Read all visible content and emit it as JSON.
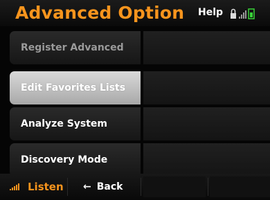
{
  "header": {
    "title": "Advanced Option",
    "help_label": "Help",
    "icons": [
      "lock-icon",
      "signal-bars-icon",
      "battery-icon"
    ]
  },
  "menu": {
    "items": [
      {
        "label": "Register Advanced",
        "state": "disabled"
      },
      {
        "label": "Edit Favorites Lists",
        "state": "selected"
      },
      {
        "label": "Analyze System",
        "state": "normal"
      },
      {
        "label": "Discovery Mode",
        "state": "normal"
      }
    ]
  },
  "bottom_bar": {
    "listen_label": "Listen",
    "back_label": "Back",
    "back_icon": "left-arrow-icon"
  },
  "colors": {
    "accent": "#f7941d",
    "battery": "#39d339"
  }
}
